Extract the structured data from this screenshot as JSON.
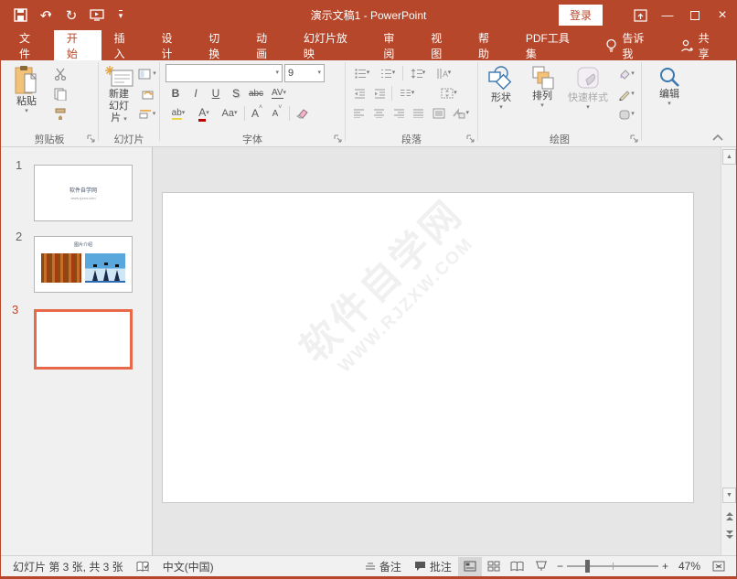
{
  "colors": {
    "accent": "#b7472a",
    "selection": "#e8684a",
    "amber": "#f2c277",
    "blue_icon": "#3b78b0"
  },
  "icons": {
    "dd": "▾",
    "undo": "↶",
    "redo": "↻",
    "minimize": "—",
    "close": "×",
    "scroll_up": "▲",
    "scroll_down": "▼",
    "zoom_in": "+",
    "zoom_out": "−",
    "collapse": "⌃"
  },
  "titlebar": {
    "title": "演示文稿1 - PowerPoint",
    "signin": "登录"
  },
  "tabs": [
    {
      "label": "文件"
    },
    {
      "label": "开始"
    },
    {
      "label": "插入"
    },
    {
      "label": "设计"
    },
    {
      "label": "切换"
    },
    {
      "label": "动画"
    },
    {
      "label": "幻灯片放映"
    },
    {
      "label": "审阅"
    },
    {
      "label": "视图"
    },
    {
      "label": "帮助"
    },
    {
      "label": "PDF工具集"
    }
  ],
  "tellme": "告诉我",
  "share": "共享",
  "ribbon": {
    "clipboard": {
      "paste": "粘贴",
      "label": "剪贴板"
    },
    "slides": {
      "line1": "新建",
      "line2": "幻灯片",
      "label": "幻灯片"
    },
    "font": {
      "label": "字体",
      "name_value": "",
      "size_value": "9",
      "bold": "B",
      "italic": "I",
      "underline": "U",
      "shadow": "S",
      "strike": "abc",
      "spacing": "AV",
      "highlight": "ab",
      "color": "A",
      "case": "Aa",
      "grow": "A",
      "shrink": "A"
    },
    "paragraph": {
      "label": "段落"
    },
    "drawing": {
      "shapes": "形状",
      "arrange": "排列",
      "quick": "快速样式",
      "label": "绘图"
    },
    "editing": {
      "label": "编辑"
    }
  },
  "slide_panel": {
    "slides": [
      {
        "number": "1",
        "title": "软件自学网",
        "subtitle": "www.rjzxw.com"
      },
      {
        "number": "2",
        "title": "图片介绍"
      },
      {
        "number": "3"
      }
    ]
  },
  "canvas": {
    "watermark_line1": "软件自学网",
    "watermark_line2": "WWW.RJZXW.COM"
  },
  "statusbar": {
    "slide_info": "幻灯片 第 3 张, 共 3 张",
    "language": "中文(中国)",
    "notes": "备注",
    "comments": "批注",
    "zoom_level": "47%"
  }
}
